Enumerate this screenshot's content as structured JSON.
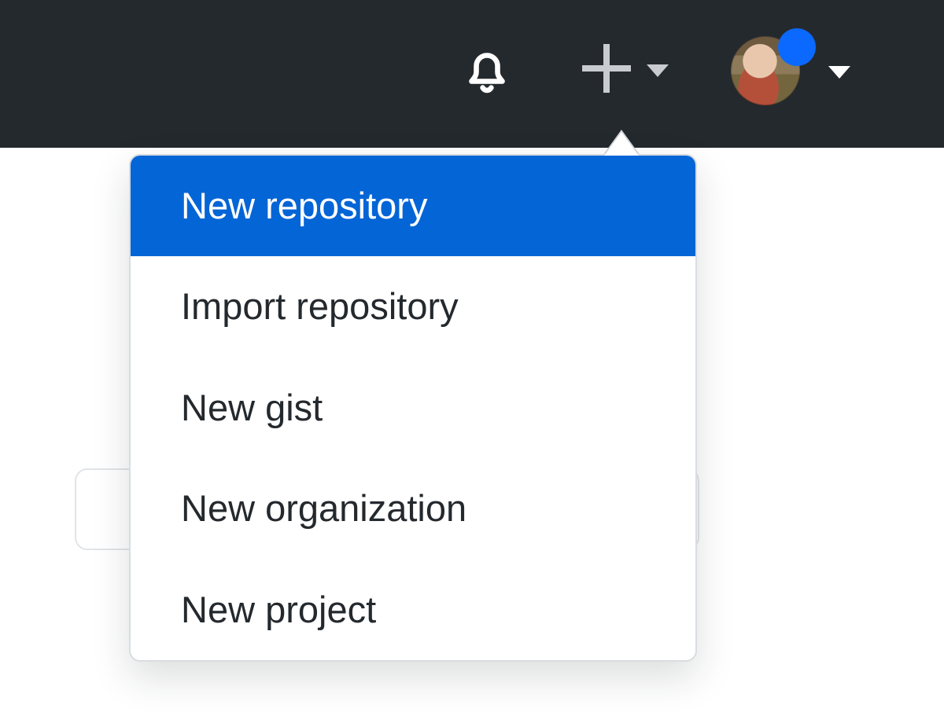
{
  "header": {
    "icons": {
      "notifications": "bell-icon",
      "create": "plus-icon",
      "create_caret": "caret-down-icon",
      "avatar_caret": "caret-down-icon"
    },
    "avatar": {
      "status_color": "#0b69ff",
      "has_status_dot": true
    }
  },
  "colors": {
    "header_bg": "#24292e",
    "highlight_bg": "#0465d6",
    "highlight_fg": "#ffffff",
    "menu_border": "#d9dde1",
    "text": "#24292e"
  },
  "create_menu": {
    "items": [
      {
        "label": "New repository",
        "highlighted": true
      },
      {
        "label": "Import repository",
        "highlighted": false
      },
      {
        "label": "New gist",
        "highlighted": false
      },
      {
        "label": "New organization",
        "highlighted": false
      },
      {
        "label": "New project",
        "highlighted": false
      }
    ]
  }
}
